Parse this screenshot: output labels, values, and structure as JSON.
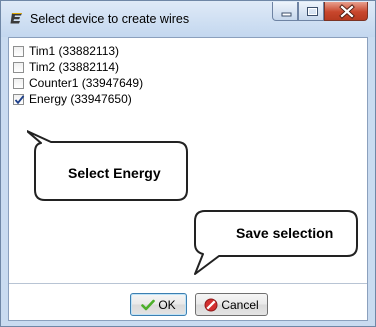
{
  "window": {
    "title": "Select device to create wires",
    "app_icon": "app-logo-icon",
    "caption_buttons": [
      "minimize-icon",
      "maximize-icon",
      "close-icon"
    ]
  },
  "device_list": {
    "items": [
      {
        "label": "Tim1 (33882113)",
        "checked": false
      },
      {
        "label": "Tim2 (33882114)",
        "checked": false
      },
      {
        "label": "Counter1 (33947649)",
        "checked": false
      },
      {
        "label": "Energy (33947650)",
        "checked": true
      }
    ]
  },
  "callouts": {
    "select_energy": "Select Energy",
    "save_selection": "Save selection"
  },
  "buttons": {
    "ok_label": "OK",
    "ok_icon": "checkmark-icon",
    "cancel_label": "Cancel",
    "cancel_icon": "no-entry-icon"
  },
  "colors": {
    "window_frame": "#c9dbf0",
    "close_button": "#c8462c",
    "ok_icon": "#4caf2a",
    "cancel_icon": "#d32f2f"
  }
}
